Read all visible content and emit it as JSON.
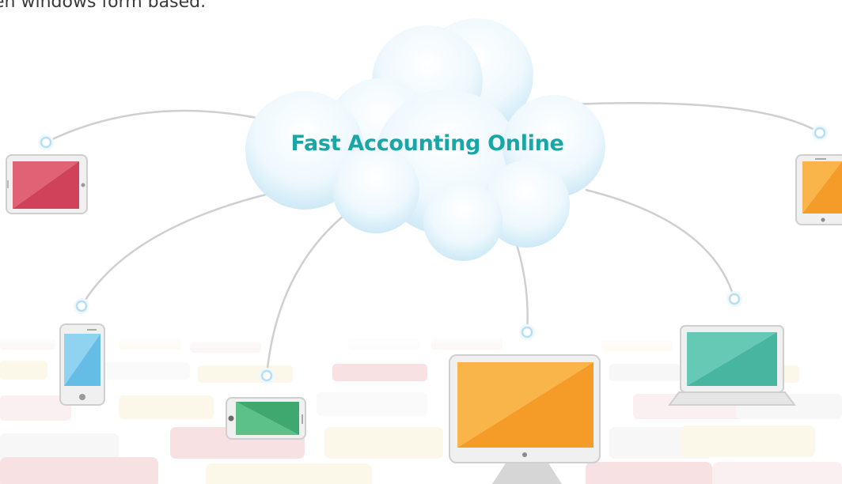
{
  "caption": "en windows form based.",
  "cloud": {
    "title": "Fast Accounting Online"
  },
  "devices": [
    {
      "name": "tablet-red",
      "icon": "tablet-icon",
      "screen_color": "#dc4a5e"
    },
    {
      "name": "phone-blue",
      "icon": "smartphone-icon",
      "screen_color": "#6cc4ea"
    },
    {
      "name": "phone-green",
      "icon": "smartphone-icon",
      "screen_color": "#45b57c"
    },
    {
      "name": "desktop-orange",
      "icon": "desktop-monitor-icon",
      "screen_color": "#f7a33a"
    },
    {
      "name": "laptop-teal",
      "icon": "laptop-icon",
      "screen_color": "#58c2ad"
    },
    {
      "name": "tablet-orange",
      "icon": "tablet-icon",
      "screen_color": "#f7a33a"
    }
  ],
  "colors": {
    "title_teal": "#1aa6a6",
    "cloud_light": "#f4fbfe",
    "cloud_blue": "#c9e8f6",
    "connector_gray": "#cfcfcf",
    "node_blue": "#bfe2f2"
  }
}
